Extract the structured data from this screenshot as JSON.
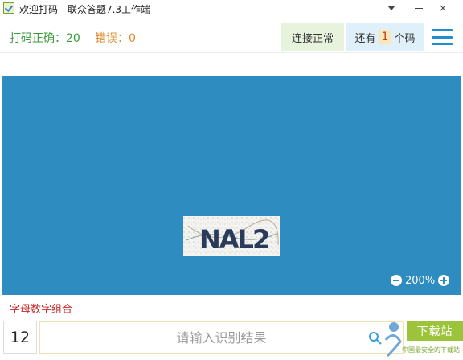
{
  "window": {
    "title": "欢迎打码 - 联众答题7.3工作端",
    "dropdown_icon": "chevron-down-icon",
    "close_glyph": "×"
  },
  "status": {
    "correct_label": "打码正确：20",
    "error_label": "错误：0",
    "connection": "连接正常",
    "remaining_prefix": "还有",
    "remaining_count": "1",
    "remaining_suffix": "个码"
  },
  "captcha": {
    "text": "NAL2",
    "zoom": "200%"
  },
  "type_label": "字母数字组合",
  "input": {
    "count": "12",
    "placeholder": "请输入识别结果"
  },
  "watermark": {
    "badge": "下载站",
    "sub": "中国最安全的下载站"
  },
  "colors": {
    "panel": "#2f8cc0",
    "accent_blue": "#1f8fd0",
    "correct_green": "#3a9a3a",
    "error_orange": "#e08a2c",
    "type_red": "#c42b2b"
  }
}
